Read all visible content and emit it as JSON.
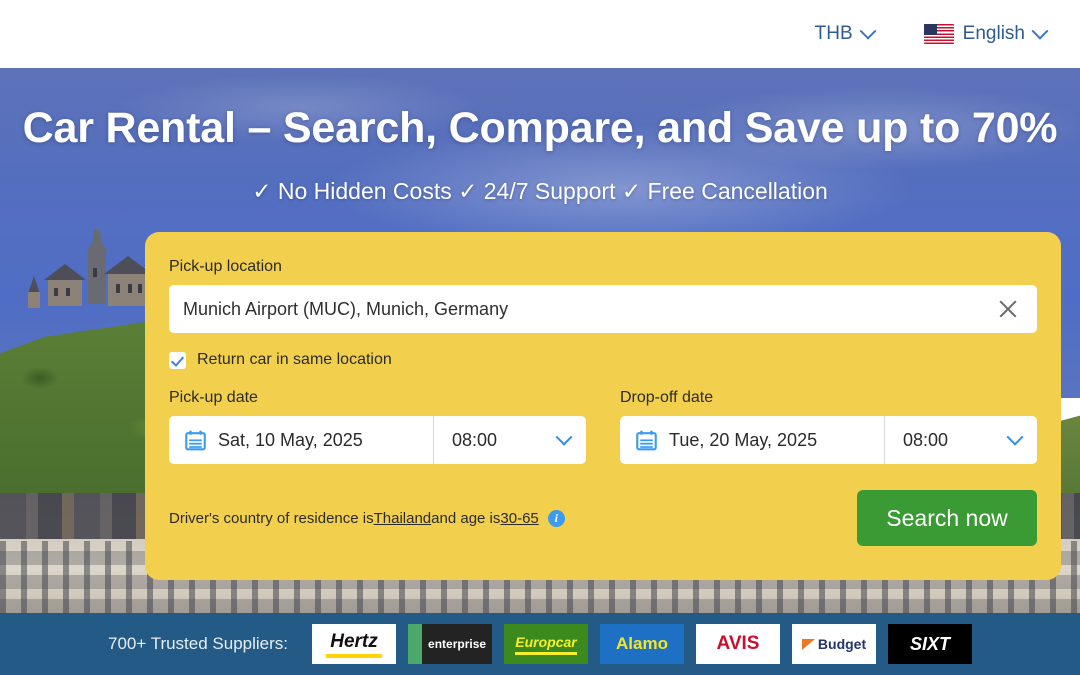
{
  "topbar": {
    "currency": "THB",
    "currency_icon": "chevron-down-icon",
    "language": "English",
    "language_flag": "us-flag-icon",
    "language_icon": "chevron-down-icon"
  },
  "hero": {
    "title": "Car Rental – Search, Compare, and Save up to 70%",
    "subtitle": "✓ No Hidden Costs ✓ 24/7 Support ✓ Free Cancellation"
  },
  "search_form": {
    "pickup_location_label": "Pick-up location",
    "pickup_location_value": "Munich Airport (MUC), Munich, Germany",
    "pickup_location_placeholder": "Pick-up location",
    "clear_icon": "close-icon",
    "same_location_checkbox_label": "Return car in same location",
    "same_location_checked": true,
    "pickup_date_label": "Pick-up date",
    "pickup_date_value": "Sat, 10 May, 2025",
    "pickup_time_value": "08:00",
    "dropoff_date_label": "Drop-off date",
    "dropoff_date_value": "Tue, 20 May, 2025",
    "dropoff_time_value": "08:00",
    "calendar_icon": "calendar-icon",
    "time_dropdown_icon": "chevron-down-icon",
    "driver_note_prefix": "Driver's country of residence is ",
    "driver_country": "Thailand",
    "driver_note_middle": " and age is ",
    "driver_age": "30-65",
    "info_icon": "info-icon",
    "info_icon_glyph": "i",
    "search_button_label": "Search now",
    "accent_color": "#f2d04e",
    "button_color": "#3a9a33"
  },
  "suppliers": {
    "label": "700+ Trusted Suppliers:",
    "band_color": "#235a86",
    "logos": [
      {
        "name": "Hertz"
      },
      {
        "name": "enterprise"
      },
      {
        "name": "Europcar"
      },
      {
        "name": "Alamo"
      },
      {
        "name": "AVIS"
      },
      {
        "name": "Budget"
      },
      {
        "name": "SIXT"
      }
    ]
  }
}
